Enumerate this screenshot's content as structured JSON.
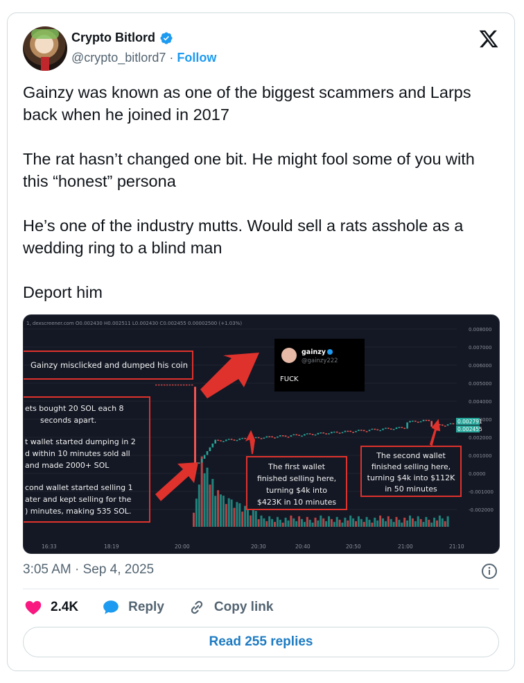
{
  "author": {
    "display_name": "Crypto Bitlord",
    "handle": "@crypto_bitlord7",
    "follow_label": "Follow",
    "separator": "·"
  },
  "tweet": {
    "paragraphs": [
      "Gainzy was known as one of the biggest scammers and Larps back when he joined in 2017",
      "The rat hasn’t changed one bit. He might fool some of you with this “honest” persona",
      "He’s one of the industry mutts. Would sell a rats asshole as a wedding ring to a blind man",
      "Deport him"
    ],
    "timestamp": "3:05 AM · Sep 4, 2025"
  },
  "actions": {
    "like_count": "2.4K",
    "reply_label": "Reply",
    "copy_label": "Copy link",
    "read_replies": "Read 255 replies"
  },
  "media": {
    "header_text": "1, dexscreener.com O0.002430 H0.002511 L0.002430 C0.002455 0.00002500 (+1.03%)",
    "embedded_tweet": {
      "name": "gainzy",
      "handle": "@gainzy222",
      "text": "FUCK"
    },
    "annotations": {
      "misclick": "Gainzy misclicked and dumped his coin",
      "wallets": [
        "ets bought 20 SOL each 8",
        "seconds apart.",
        "",
        "t wallet started dumping in 2",
        "d within 10 minutes sold all",
        "and made 2000+ SOL",
        "",
        "cond wallet started selling 1",
        "ater and kept selling for the",
        ") minutes, making 535 SOL."
      ],
      "first_wallet": [
        "The first wallet",
        "finished selling here,",
        "turning $4k into",
        "$423K in 10 minutes"
      ],
      "second_wallet": [
        "The second wallet",
        "finished selling here,",
        "turning $4k into $112K",
        "in 50 minutes"
      ]
    },
    "colors": {
      "up": "#26a69a",
      "down": "#ef5350",
      "annotation": "#e0322d",
      "background": "#141824"
    }
  },
  "chart_data": {
    "type": "bar",
    "title": "",
    "x_ticks": [
      "16:33",
      "18:19",
      "20:00",
      "20:30",
      "20:40",
      "20:50",
      "21:00",
      "21:10"
    ],
    "y_ticks": [
      "0.008000",
      "0.007000",
      "0.006000",
      "0.005000",
      "0.004000",
      "0.003000",
      "0.002000",
      "0.001000",
      "0.0000",
      "-0.001000",
      "-0.002000"
    ],
    "price_labels": [
      "0.002791",
      "0.002455"
    ],
    "price_series": [
      {
        "x": "16:33",
        "y": 0.0049
      },
      {
        "x": "18:19",
        "y": 0.0048
      },
      {
        "x": "20:00",
        "y": 0.0048
      },
      {
        "x": "20:01",
        "y": 0.0003
      },
      {
        "x": "20:05",
        "y": 0.0018
      },
      {
        "x": "20:30",
        "y": 0.002
      },
      {
        "x": "20:40",
        "y": 0.0022
      },
      {
        "x": "20:50",
        "y": 0.0023
      },
      {
        "x": "21:00",
        "y": 0.0024
      },
      {
        "x": "21:05",
        "y": 0.0028
      },
      {
        "x": "21:10",
        "y": 0.00245
      }
    ],
    "volume_series": [
      {
        "x": "20:00",
        "value": 8
      },
      {
        "x": "20:05",
        "value": 62
      },
      {
        "x": "20:10",
        "value": 45
      },
      {
        "x": "20:20",
        "value": 28
      },
      {
        "x": "20:30",
        "value": 14
      },
      {
        "x": "20:40",
        "value": 9
      },
      {
        "x": "20:50",
        "value": 7
      },
      {
        "x": "21:00",
        "value": 6
      },
      {
        "x": "21:10",
        "value": 5
      }
    ]
  }
}
